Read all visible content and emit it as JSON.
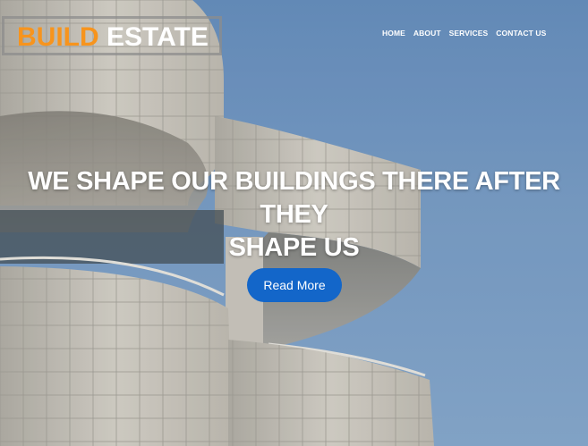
{
  "logo": {
    "part1": "BUILD",
    "part2": "ESTATE"
  },
  "nav": {
    "items": [
      "HOME",
      "ABOUT",
      "SERVICES",
      "CONTACT US"
    ]
  },
  "hero": {
    "line1": "WE SHAPE OUR BUILDINGS THERE AFTER THEY",
    "line2": "SHAPE US",
    "button_label": "Read More"
  },
  "colors": {
    "accent": "#f7941d",
    "button": "#1366c9",
    "sky": "#7ea4cf"
  }
}
